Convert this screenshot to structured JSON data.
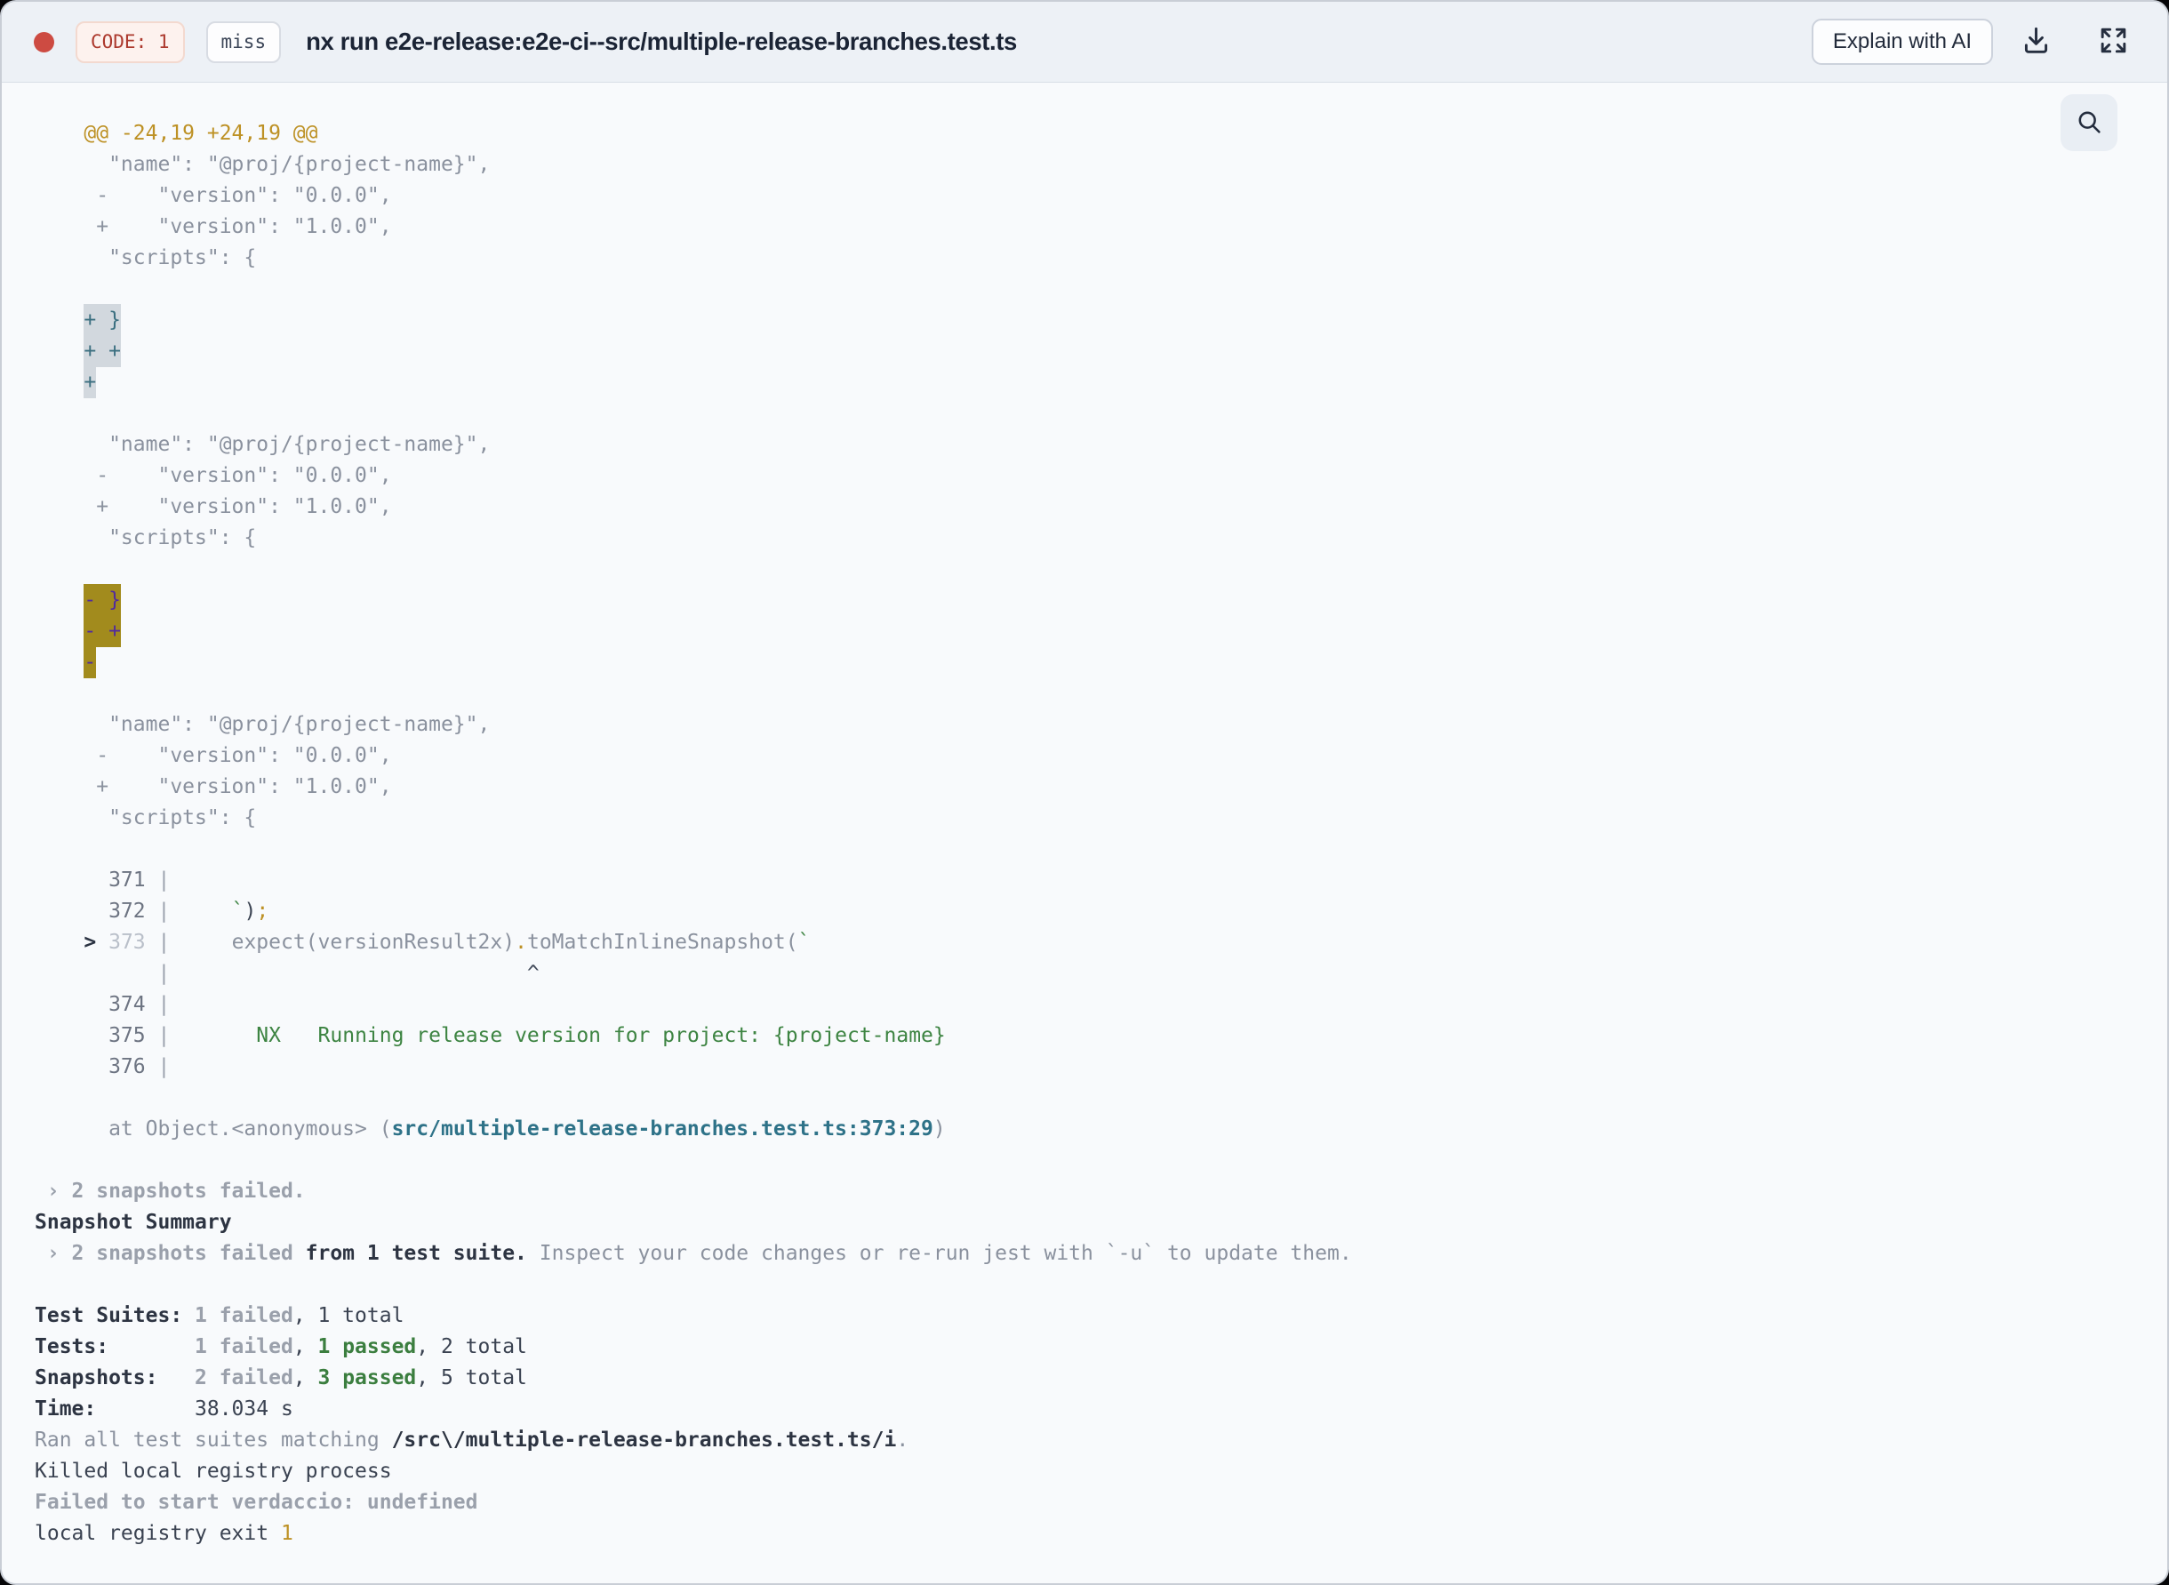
{
  "header": {
    "exit_code_badge": "CODE: 1",
    "cache_status_badge": "miss",
    "title": "nx run e2e-release:e2e-ci--src/multiple-release-branches.test.ts",
    "explain_button_label": "Explain with AI",
    "icons": [
      "download-icon",
      "fullscreen-expand-icon"
    ],
    "status_icon": "red-record-dot"
  },
  "toolbar": {
    "search_icon": "magnifier"
  },
  "colors": {
    "status_red": "#cd4b42",
    "exit_code_text": "#ac392d",
    "diff_hunk_yellow": "#bd9125",
    "success_green": "#3d8442",
    "file_link_teal": "#2e7288",
    "selection_add_bg": "#d2d8de",
    "selection_add_text": "#3b6f80",
    "selection_del_bg": "#a28b1d",
    "selection_del_text": "#512b9e"
  },
  "terminal": {
    "lines": [
      [
        {
          "t": "    @@ -24,19 +24,19 @@",
          "c": "y"
        }
      ],
      [
        {
          "t": "      \"name\": \"@proj/{project-name}\",",
          "c": "g"
        }
      ],
      [
        {
          "t": "     -    \"version\": \"0.0.0\",",
          "c": "g"
        }
      ],
      [
        {
          "t": "     +    \"version\": \"1.0.0\",",
          "c": "g"
        }
      ],
      [
        {
          "t": "      \"scripts\": {",
          "c": "g"
        }
      ],
      [],
      [
        {
          "t": "    ",
          "c": "g"
        },
        {
          "t": "+ }",
          "c": "sa"
        }
      ],
      [
        {
          "t": "    ",
          "c": "g"
        },
        {
          "t": "+ +",
          "c": "sa"
        }
      ],
      [
        {
          "t": "    ",
          "c": "g"
        },
        {
          "t": "+",
          "c": "sa"
        }
      ],
      [],
      [
        {
          "t": "      \"name\": \"@proj/{project-name}\",",
          "c": "g"
        }
      ],
      [
        {
          "t": "     -    \"version\": \"0.0.0\",",
          "c": "g"
        }
      ],
      [
        {
          "t": "     +    \"version\": \"1.0.0\",",
          "c": "g"
        }
      ],
      [
        {
          "t": "      \"scripts\": {",
          "c": "g"
        }
      ],
      [],
      [
        {
          "t": "    ",
          "c": "g"
        },
        {
          "t": "- }",
          "c": "sd"
        }
      ],
      [
        {
          "t": "    ",
          "c": "g"
        },
        {
          "t": "- +",
          "c": "sd"
        }
      ],
      [
        {
          "t": "    ",
          "c": "g"
        },
        {
          "t": "-",
          "c": "sd"
        }
      ],
      [],
      [
        {
          "t": "      \"name\": \"@proj/{project-name}\",",
          "c": "g"
        }
      ],
      [
        {
          "t": "     -    \"version\": \"0.0.0\",",
          "c": "g"
        }
      ],
      [
        {
          "t": "     +    \"version\": \"1.0.0\",",
          "c": "g"
        }
      ],
      [
        {
          "t": "      \"scripts\": {",
          "c": "g"
        }
      ],
      [],
      [
        {
          "t": "      371 ",
          "c": "num"
        },
        {
          "t": "|",
          "c": "pipe"
        }
      ],
      [
        {
          "t": "      372 ",
          "c": "num"
        },
        {
          "t": "|",
          "c": "pipe"
        },
        {
          "t": "     ",
          "c": "g"
        },
        {
          "t": "`",
          "c": "gr"
        },
        {
          "t": ")",
          "c": "d"
        },
        {
          "t": ";",
          "c": "y"
        }
      ],
      [
        {
          "t": "    ",
          "c": "g"
        },
        {
          "t": ">",
          "c": "arr"
        },
        {
          "t": " ",
          "c": "g"
        },
        {
          "t": "373",
          "c": "dim"
        },
        {
          "t": " ",
          "c": "g"
        },
        {
          "t": "|",
          "c": "pipe"
        },
        {
          "t": "     expect(versionResult2x)",
          "c": "g"
        },
        {
          "t": ".",
          "c": "y"
        },
        {
          "t": "toMatchInlineSnapshot(",
          "c": "g"
        },
        {
          "t": "`",
          "c": "gr"
        }
      ],
      [
        {
          "t": "          ",
          "c": "g"
        },
        {
          "t": "|",
          "c": "pipe"
        },
        {
          "t": "                             ",
          "c": "g"
        },
        {
          "t": "^",
          "c": "car"
        }
      ],
      [
        {
          "t": "      374 ",
          "c": "num"
        },
        {
          "t": "|",
          "c": "pipe"
        }
      ],
      [
        {
          "t": "      375 ",
          "c": "num"
        },
        {
          "t": "|",
          "c": "pipe"
        },
        {
          "t": "       ",
          "c": "g"
        },
        {
          "t": "NX",
          "c": "gr"
        },
        {
          "t": "   ",
          "c": "g"
        },
        {
          "t": "Running release version for project: {project-name}",
          "c": "gr"
        }
      ],
      [
        {
          "t": "      376 ",
          "c": "num"
        },
        {
          "t": "|",
          "c": "pipe"
        }
      ],
      [],
      [
        {
          "t": "      at Object.<anonymous> (",
          "c": "g"
        },
        {
          "t": "src/multiple-release-branches.test.ts:373:29",
          "c": "tl"
        },
        {
          "t": ")",
          "c": "g"
        }
      ],
      [],
      [
        {
          "t": " › 2 snapshots failed.",
          "c": "bg"
        }
      ],
      [
        {
          "t": "Snapshot Summary",
          "c": "bd"
        }
      ],
      [
        {
          "t": " › 2 snapshots failed",
          "c": "bg"
        },
        {
          "t": " from 1 test suite.",
          "c": "bd"
        },
        {
          "t": " Inspect your code changes or re-run jest with `-u` to update them.",
          "c": "g"
        }
      ],
      [],
      [
        {
          "t": "Test Suites: ",
          "c": "bd"
        },
        {
          "t": "1 failed",
          "c": "bg"
        },
        {
          "t": ", 1 total",
          "c": "d"
        }
      ],
      [
        {
          "t": "Tests:       ",
          "c": "bd"
        },
        {
          "t": "1 failed",
          "c": "bg"
        },
        {
          "t": ", ",
          "c": "d"
        },
        {
          "t": "1 passed",
          "c": "bgr"
        },
        {
          "t": ", 2 total",
          "c": "d"
        }
      ],
      [
        {
          "t": "Snapshots:   ",
          "c": "bd"
        },
        {
          "t": "2 failed",
          "c": "bg"
        },
        {
          "t": ", ",
          "c": "d"
        },
        {
          "t": "3 passed",
          "c": "bgr"
        },
        {
          "t": ", 5 total",
          "c": "d"
        }
      ],
      [
        {
          "t": "Time:        ",
          "c": "bd"
        },
        {
          "t": "38.034 s",
          "c": "d"
        }
      ],
      [
        {
          "t": "Ran all test suites matching ",
          "c": "g"
        },
        {
          "t": "/src\\/multiple-release-branches.test.ts/i",
          "c": "bd"
        },
        {
          "t": ".",
          "c": "g"
        }
      ],
      [
        {
          "t": "Killed local registry process",
          "c": "d"
        }
      ],
      [
        {
          "t": "Failed to start verdaccio: undefined",
          "c": "bg"
        }
      ],
      [
        {
          "t": "local registry exit ",
          "c": "d"
        },
        {
          "t": "1",
          "c": "y"
        }
      ]
    ]
  }
}
